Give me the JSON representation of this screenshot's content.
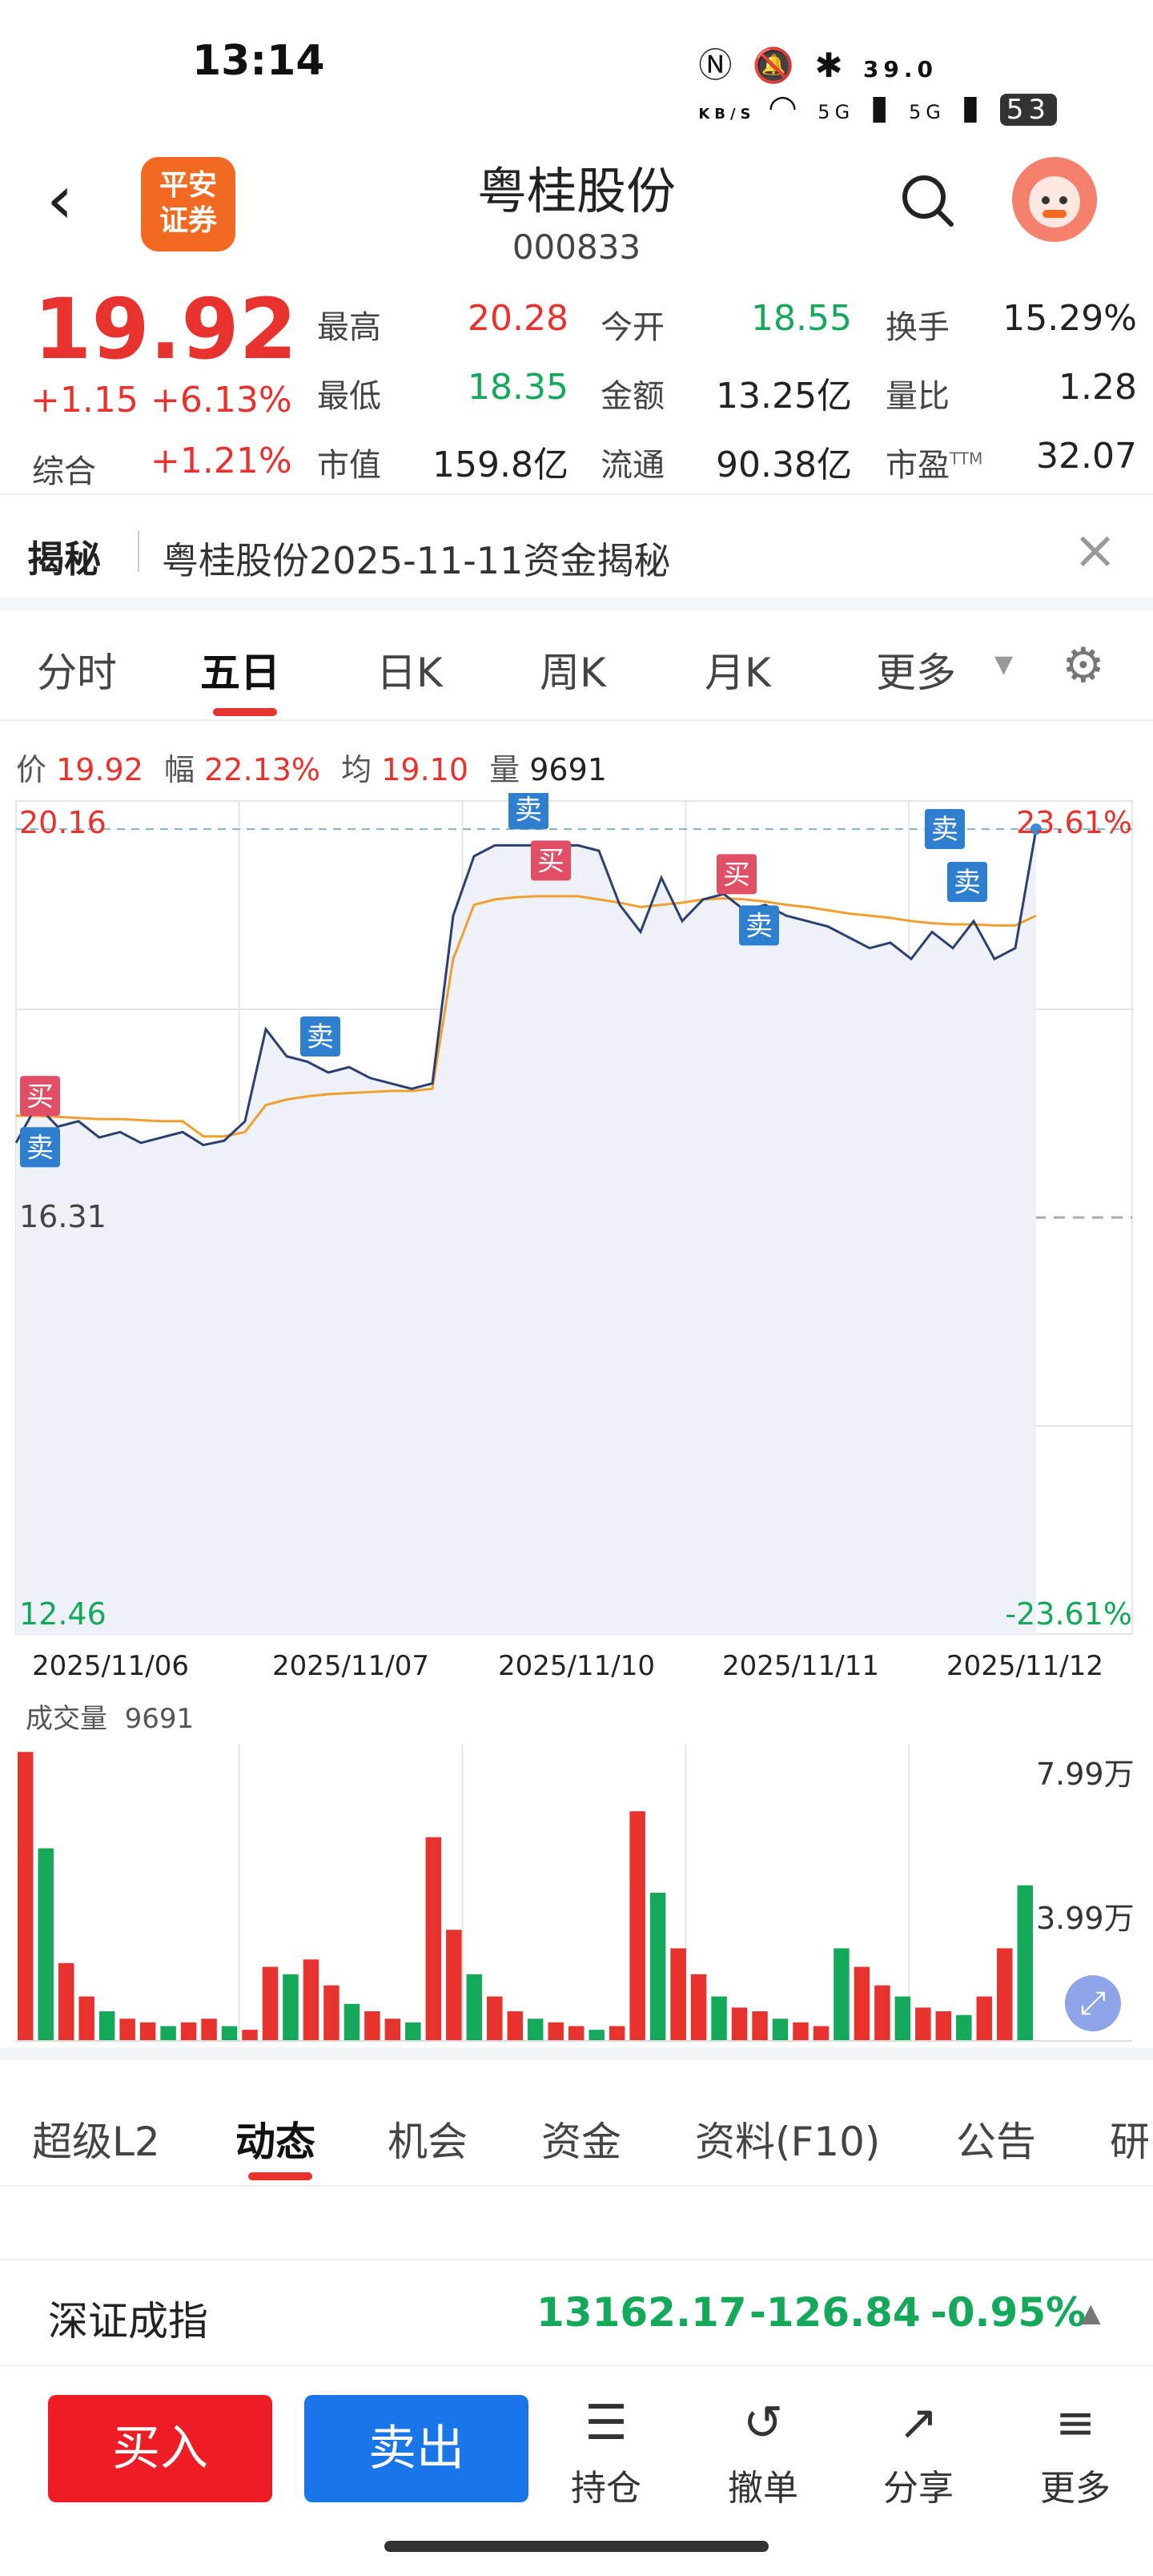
{
  "status": {
    "time": "13:14",
    "network_speed": "39.0",
    "network_unit": "KB/S",
    "signal1": "5G",
    "signal2": "5G",
    "battery": "53"
  },
  "header": {
    "back_icon": "chevron-left-icon",
    "broker_logo": "平安证券",
    "title": "粤桂股份",
    "code": "000833"
  },
  "quote": {
    "price": "19.92",
    "change": "+1.15",
    "change_pct": "+6.13%",
    "index_label": "综合",
    "index_change": "+1.21%",
    "fields": [
      {
        "label": "最高",
        "value": "20.28",
        "color": "red"
      },
      {
        "label": "今开",
        "value": "18.55",
        "color": "green"
      },
      {
        "label": "换手",
        "value": "15.29%",
        "color": "gray"
      },
      {
        "label": "最低",
        "value": "18.35",
        "color": "green"
      },
      {
        "label": "金额",
        "value": "13.25亿",
        "color": "gray"
      },
      {
        "label": "量比",
        "value": "1.28",
        "color": "gray"
      },
      {
        "label": "市值",
        "value": "159.8亿",
        "color": "gray"
      },
      {
        "label": "流通",
        "value": "90.38亿",
        "color": "gray"
      },
      {
        "label": "市盈",
        "value": "32.07",
        "color": "gray",
        "sup": "TTM"
      }
    ]
  },
  "reveal": {
    "tag": "揭秘",
    "text": "粤桂股份2025-11-11资金揭秘"
  },
  "chart_tabs": [
    "分时",
    "五日",
    "日K",
    "周K",
    "月K",
    "更多"
  ],
  "chart_info": {
    "price_label": "价",
    "price": "19.92",
    "range_label": "幅",
    "range": "22.13%",
    "avg_label": "均",
    "avg": "19.10",
    "vol_label": "量",
    "vol": "9691"
  },
  "chart_axes": {
    "top": "20.16",
    "mid": "16.31",
    "bottom": "12.46",
    "top_pct": "23.61%",
    "bottom_pct": "-23.61%"
  },
  "chart_data": {
    "type": "line",
    "title": "",
    "x": [
      "2025/11/06",
      "2025/11/07",
      "2025/11/10",
      "2025/11/11",
      "2025/11/12"
    ],
    "ylim": [
      12.46,
      20.16
    ],
    "series": [
      {
        "name": "",
        "values": [
          17.0,
          17.35,
          17.15,
          17.2,
          17.05,
          17.1,
          17.0,
          17.05,
          17.1,
          16.98,
          17.02,
          17.2,
          18.05,
          17.8,
          17.75,
          17.65,
          17.7,
          17.6,
          17.55,
          17.5,
          17.55,
          19.1,
          19.65,
          19.75,
          19.75,
          19.75,
          19.75,
          19.75,
          19.7,
          19.2,
          18.95,
          19.45,
          19.05,
          19.25,
          19.3,
          19.15,
          19.2,
          19.1,
          19.05,
          19.0,
          18.9,
          18.8,
          18.85,
          18.7,
          18.95,
          18.8,
          19.05,
          18.7,
          18.8,
          19.9
        ]
      },
      {
        "name": "",
        "values": [
          17.25,
          17.25,
          17.24,
          17.23,
          17.22,
          17.22,
          17.21,
          17.2,
          17.2,
          17.06,
          17.06,
          17.1,
          17.35,
          17.4,
          17.43,
          17.45,
          17.46,
          17.47,
          17.48,
          17.48,
          17.5,
          18.7,
          19.2,
          19.25,
          19.27,
          19.28,
          19.28,
          19.28,
          19.25,
          19.22,
          19.18,
          19.2,
          19.22,
          19.25,
          19.26,
          19.25,
          19.23,
          19.2,
          19.18,
          19.15,
          19.12,
          19.1,
          19.08,
          19.05,
          19.03,
          19.02,
          19.02,
          19.01,
          19.01,
          19.1
        ]
      }
    ],
    "trade_marks": [
      {
        "label": "买",
        "kind": "buy",
        "day": 0
      },
      {
        "label": "卖",
        "kind": "sell",
        "day": 0
      },
      {
        "label": "卖",
        "kind": "sell",
        "day": 1
      },
      {
        "label": "卖",
        "kind": "sell",
        "day": 2
      },
      {
        "label": "买",
        "kind": "buy",
        "day": 2
      },
      {
        "label": "买",
        "kind": "buy",
        "day": 3
      },
      {
        "label": "卖",
        "kind": "sell",
        "day": 3
      },
      {
        "label": "卖",
        "kind": "sell",
        "day": 4
      },
      {
        "label": "卖",
        "kind": "sell",
        "day": 4
      }
    ]
  },
  "volume": {
    "label": "成交量",
    "value": "9691",
    "max": "7.99万",
    "mid": "3.99万",
    "bars": [
      7.8,
      5.2,
      2.1,
      1.2,
      0.8,
      0.6,
      0.5,
      0.4,
      0.5,
      0.6,
      0.4,
      0.3,
      2.0,
      1.8,
      2.2,
      1.5,
      1.0,
      0.8,
      0.6,
      0.5,
      5.5,
      3.0,
      1.8,
      1.2,
      0.8,
      0.6,
      0.5,
      0.4,
      0.3,
      0.4,
      6.2,
      4.0,
      2.5,
      1.8,
      1.2,
      0.9,
      0.8,
      0.6,
      0.5,
      0.4,
      2.5,
      2.0,
      1.5,
      1.2,
      0.9,
      0.8,
      0.7,
      1.2,
      2.5,
      4.2
    ]
  },
  "bottom_tabs": [
    "超级L2",
    "动态",
    "机会",
    "资金",
    "资料(F10)",
    "公告",
    "研"
  ],
  "ticker": {
    "name": "深证成指",
    "value": "13162.17",
    "change": "-126.84",
    "pct": "-0.95%"
  },
  "actions": {
    "buy": "买入",
    "sell": "卖出",
    "items": [
      {
        "label": "持仓",
        "icon": "position-icon",
        "glyph": "☰"
      },
      {
        "label": "撤单",
        "icon": "cancel-order-icon",
        "glyph": "↺"
      },
      {
        "label": "分享",
        "icon": "share-icon",
        "glyph": "↗"
      },
      {
        "label": "更多",
        "icon": "more-icon",
        "glyph": "≡"
      }
    ]
  },
  "colors": {
    "up": "#e8322e",
    "down": "#14a85b",
    "line": "#2b3f73",
    "avg": "#f0a030",
    "buy": "#e8322e",
    "sell": "#1976e8"
  }
}
